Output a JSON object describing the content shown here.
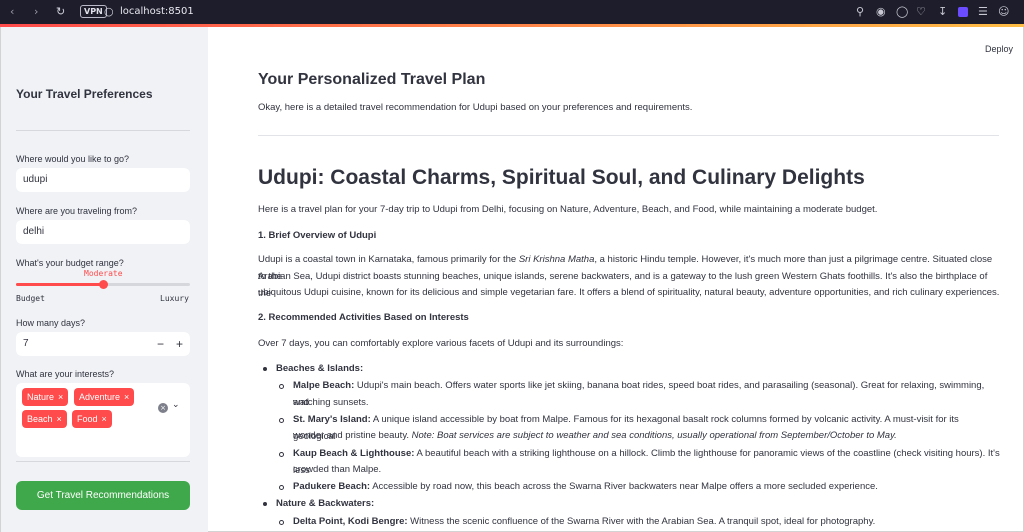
{
  "browser": {
    "url": "localhost:8501",
    "vpn_label": "VPN"
  },
  "sidebar": {
    "title": "Your Travel Preferences",
    "destination": {
      "label": "Where would you like to go?",
      "value": "udupi"
    },
    "origin": {
      "label": "Where are you traveling from?",
      "value": "delhi"
    },
    "budget": {
      "label": "What's your budget range?",
      "value": "Moderate",
      "min_label": "Budget",
      "max_label": "Luxury",
      "position_fraction": 0.5
    },
    "days": {
      "label": "How many days?",
      "value": "7",
      "minus": "−",
      "plus": "+"
    },
    "interests": {
      "label": "What are your interests?",
      "chips": [
        "Nature",
        "Adventure",
        "Beach",
        "Food"
      ]
    },
    "submit_label": "Get Travel Recommendations"
  },
  "header": {
    "deploy_label": "Deploy"
  },
  "main": {
    "title": "Your Personalized Travel Plan",
    "intro": "Okay, here is a detailed travel recommendation for Udupi based on your preferences and requirements.",
    "heading": "Udupi: Coastal Charms, Spiritual Soul, and Culinary Delights",
    "lead": "Here is a travel plan for your 7-day trip to Udupi from Delhi, focusing on Nature, Adventure, Beach, and Food, while maintaining a moderate budget.",
    "section1_title": "1. Brief Overview of Udupi",
    "overview_a": "Udupi is a coastal town in Karnataka, famous primarily for the ",
    "overview_em": "Sri Krishna Matha",
    "overview_b": ", a historic Hindu temple. However, it's much more than just a pilgrimage centre. Situated close to the",
    "overview_line2": "Arabian Sea, Udupi district boasts stunning beaches, unique islands, serene backwaters, and is a gateway to the lush green Western Ghats foothills. It's also the birthplace of the",
    "overview_line3": "ubiquitous Udupi cuisine, known for its delicious and simple vegetarian fare. It offers a blend of spirituality, natural beauty, adventure opportunities, and rich culinary experiences.",
    "section2_title": "2. Recommended Activities Based on Interests",
    "section2_lead": "Over 7 days, you can comfortably explore various facets of Udupi and its surroundings:",
    "group1": "Beaches & Islands:",
    "malpe_name": "Malpe Beach:",
    "malpe_text": " Udupi's main beach. Offers water sports like jet skiing, banana boat rides, speed boat rides, and parasailing (seasonal). Great for relaxing, swimming, and",
    "malpe_text2": "watching sunsets.",
    "stmary_name": "St. Mary's Island:",
    "stmary_text": " A unique island accessible by boat from Malpe. Famous for its hexagonal basalt rock columns formed by volcanic activity. A must-visit for its geological",
    "stmary_text2a": "wonder and pristine beauty. ",
    "stmary_note": "Note: Boat services are subject to weather and sea conditions, usually operational from September/October to May.",
    "kaup_name": "Kaup Beach & Lighthouse:",
    "kaup_text": " A beautiful beach with a striking lighthouse on a hillock. Climb the lighthouse for panoramic views of the coastline (check visiting hours). It's less",
    "kaup_text2": "crowded than Malpe.",
    "padukere_name": "Padukere Beach:",
    "padukere_text": " Accessible by road now, this beach across the Swarna River backwaters near Malpe offers a more secluded experience.",
    "group2": "Nature & Backwaters:",
    "delta_name": "Delta Point, Kodi Bengre:",
    "delta_text": " Witness the scenic confluence of the Swarna River with the Arabian Sea. A tranquil spot, ideal for photography."
  },
  "colors": {
    "accent": "#ff4b4b",
    "button": "#3fa84a",
    "sidebar_bg": "#f0f2f6",
    "text": "#31333f"
  }
}
